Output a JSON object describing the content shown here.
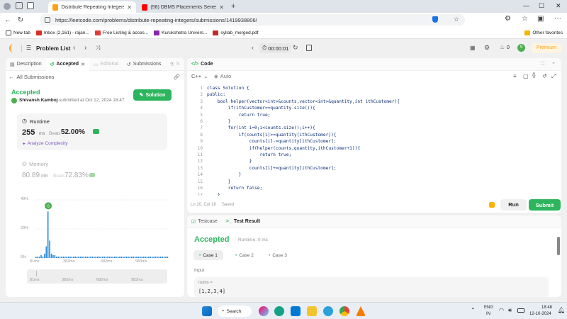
{
  "browser": {
    "tabs": [
      {
        "title": "Distribute Repeating Integers - Le",
        "active": true
      },
      {
        "title": "(58) DBMS Placements Series 202",
        "active": false
      }
    ],
    "new_tab": "+",
    "url": "https://leetcode.com/problems/distribute-repeating-integers/submissions/1419938806/",
    "bookmarks": [
      "New tab",
      "Inbox (2,161) - rajan...",
      "Free Listing & acces...",
      "Kurukshetra Univers...",
      "syllab_merged.pdf"
    ],
    "other_favorites": "Other favorites"
  },
  "topbar": {
    "problem_list": "Problem List",
    "timer": "00:00:01",
    "streak": "0",
    "premium": "Premium",
    "avatar": "S"
  },
  "left_panel": {
    "tabs": [
      "Description",
      "Accepted",
      "Editorial",
      "Submissions",
      "S"
    ],
    "all_submissions": "All Submissions",
    "status": "Accepted",
    "user": "Shivansh Kamboj",
    "submitted": "submitted at Oct 12, 2024 18:47",
    "solution_btn": "Solution",
    "runtime": {
      "label": "Runtime",
      "value": "255",
      "unit": "ms",
      "beats_label": "Beats",
      "beats": "52.00%",
      "analyze": "Analyze Complexity"
    },
    "memory": {
      "label": "Memory",
      "value": "80.89",
      "unit": "MB",
      "beats_label": "Beats",
      "beats": "72.83%"
    },
    "chart": {
      "y_ticks": [
        "40%",
        "20%",
        "0%"
      ],
      "x_ticks": [
        "81ms",
        "382ms",
        "682ms",
        "983ms"
      ],
      "mini_ticks": [
        "81ms",
        "382ms",
        "682ms",
        "983ms"
      ],
      "marker": "S"
    }
  },
  "code_panel": {
    "title": "Code",
    "language": "C++",
    "auto": "Auto",
    "lines": [
      "class Solution {",
      "public:",
      "    bool helper(vector<int>&counts,vector<int>&quantity,int ithCustomer){",
      "        if(ithCustomer==quantity.size()){",
      "            return true;",
      "        }",
      "        for(int i=0;i<counts.size();i++){",
      "            if(counts[i]>=quantity[ithCustomer]){",
      "                counts[i]-=quantity[ithCustomer];",
      "                if(helper(counts,quantity,ithCustomer+1)){",
      "                    return true;",
      "                }",
      "                counts[i]+=quantity[ithCustomer];",
      "            }",
      "        }",
      "        return false;",
      "    }"
    ],
    "line_numbers": [
      "1",
      "2",
      "3",
      "4",
      "5",
      "6",
      "7",
      "8",
      "9",
      "10",
      "11",
      "12",
      "13",
      "14",
      "15",
      "16",
      "17"
    ],
    "status": "Ln 20, Col 18",
    "saved": "Saved",
    "run": "Run",
    "submit": "Submit"
  },
  "test_panel": {
    "tab_testcase": "Testcase",
    "tab_result": "Test Result",
    "result": "Accepted",
    "runtime": "Runtime: 0 ms",
    "cases": [
      "Case 1",
      "Case 2",
      "Case 3"
    ],
    "input_label": "Input",
    "param": "nums =",
    "value": "[1,2,3,4]"
  },
  "taskbar": {
    "search": "Search",
    "lang": "ENG",
    "region": "IN",
    "time": "18:48",
    "date": "12-10-2024"
  },
  "chart_data": {
    "type": "bar",
    "title": "",
    "xlabel": "",
    "ylabel": "",
    "ylim": [
      0,
      40
    ],
    "x_ticks": [
      "81ms",
      "382ms",
      "682ms",
      "983ms"
    ],
    "values": [
      1,
      1,
      1,
      2,
      1,
      3,
      8,
      32,
      12,
      3,
      2,
      2,
      1,
      1,
      1,
      1,
      1,
      1,
      1,
      1,
      1,
      1,
      1,
      1,
      1,
      1,
      1,
      1,
      1,
      1,
      1,
      1,
      1,
      1,
      1,
      1,
      1,
      1,
      1,
      1,
      1,
      1,
      1,
      1,
      1,
      1,
      1,
      1,
      1,
      1,
      1,
      1,
      1,
      1,
      1,
      1,
      1,
      1,
      1,
      1,
      1,
      1,
      1,
      1,
      1,
      1,
      1,
      1,
      1,
      1,
      1,
      1,
      1,
      1,
      1,
      1,
      1,
      1
    ],
    "highlight_index": 7
  }
}
